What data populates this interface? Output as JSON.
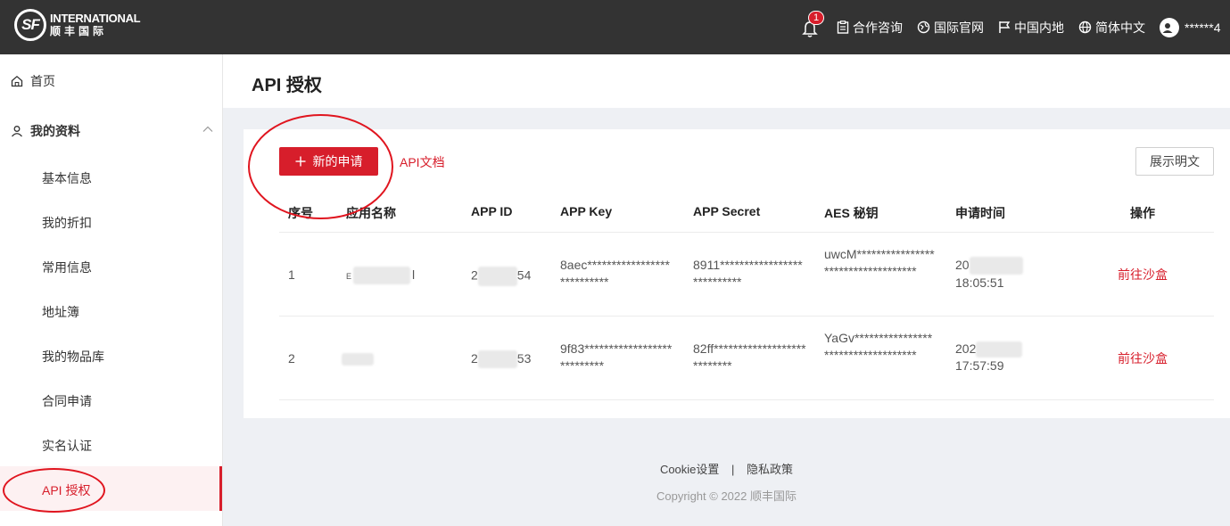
{
  "header": {
    "logo_mark": "SF",
    "logo_en": "INTERNATIONAL",
    "logo_cn": "顺丰国际",
    "notification_count": "1",
    "nav": [
      {
        "label": "合作咨询",
        "icon": "clipboard-icon"
      },
      {
        "label": "国际官网",
        "icon": "globe-pin-icon"
      },
      {
        "label": "中国内地",
        "icon": "flag-icon"
      },
      {
        "label": "简体中文",
        "icon": "language-globe-icon"
      }
    ],
    "user": "******4"
  },
  "sidebar": {
    "home": "首页",
    "profile": "我的资料",
    "items": [
      "基本信息",
      "我的折扣",
      "常用信息",
      "地址簿",
      "我的物品库",
      "合同申请",
      "实名认证",
      "API 授权"
    ]
  },
  "page": {
    "title": "API 授权",
    "new_button": "新的申请",
    "api_doc": "API文档",
    "show_plain": "展示明文"
  },
  "table": {
    "headers": [
      "序号",
      "应用名称",
      "APP ID",
      "APP Key",
      "APP Secret",
      "AES 秘钥",
      "申请时间",
      "操作"
    ],
    "rows": [
      {
        "index": "1",
        "app_name": "E",
        "app_name_tail": "l",
        "app_id_head": "2",
        "app_id_tail": "54",
        "app_key": "8aec***************************",
        "app_secret": "8911***************************",
        "aes_key": "uwcM***********************************",
        "time_head": "20",
        "time_tail": "18:05:51",
        "action": "前往沙盒"
      },
      {
        "index": "2",
        "app_name": "",
        "app_name_tail": "",
        "app_id_head": "2",
        "app_id_tail": "53",
        "app_key": "9f83***************************",
        "app_secret": "82ff***************************",
        "aes_key": "YaGv***********************************",
        "time_head": "202",
        "time_tail": "17:57:59",
        "action": "前往沙盒"
      }
    ]
  },
  "footer": {
    "cookie": "Cookie设置",
    "separator": "|",
    "privacy": "隐私政策",
    "copyright": "Copyright © 2022 顺丰国际"
  },
  "colors": {
    "brand_red": "#d71e2b",
    "header_bg": "#333333",
    "page_bg": "#eef0f4"
  }
}
